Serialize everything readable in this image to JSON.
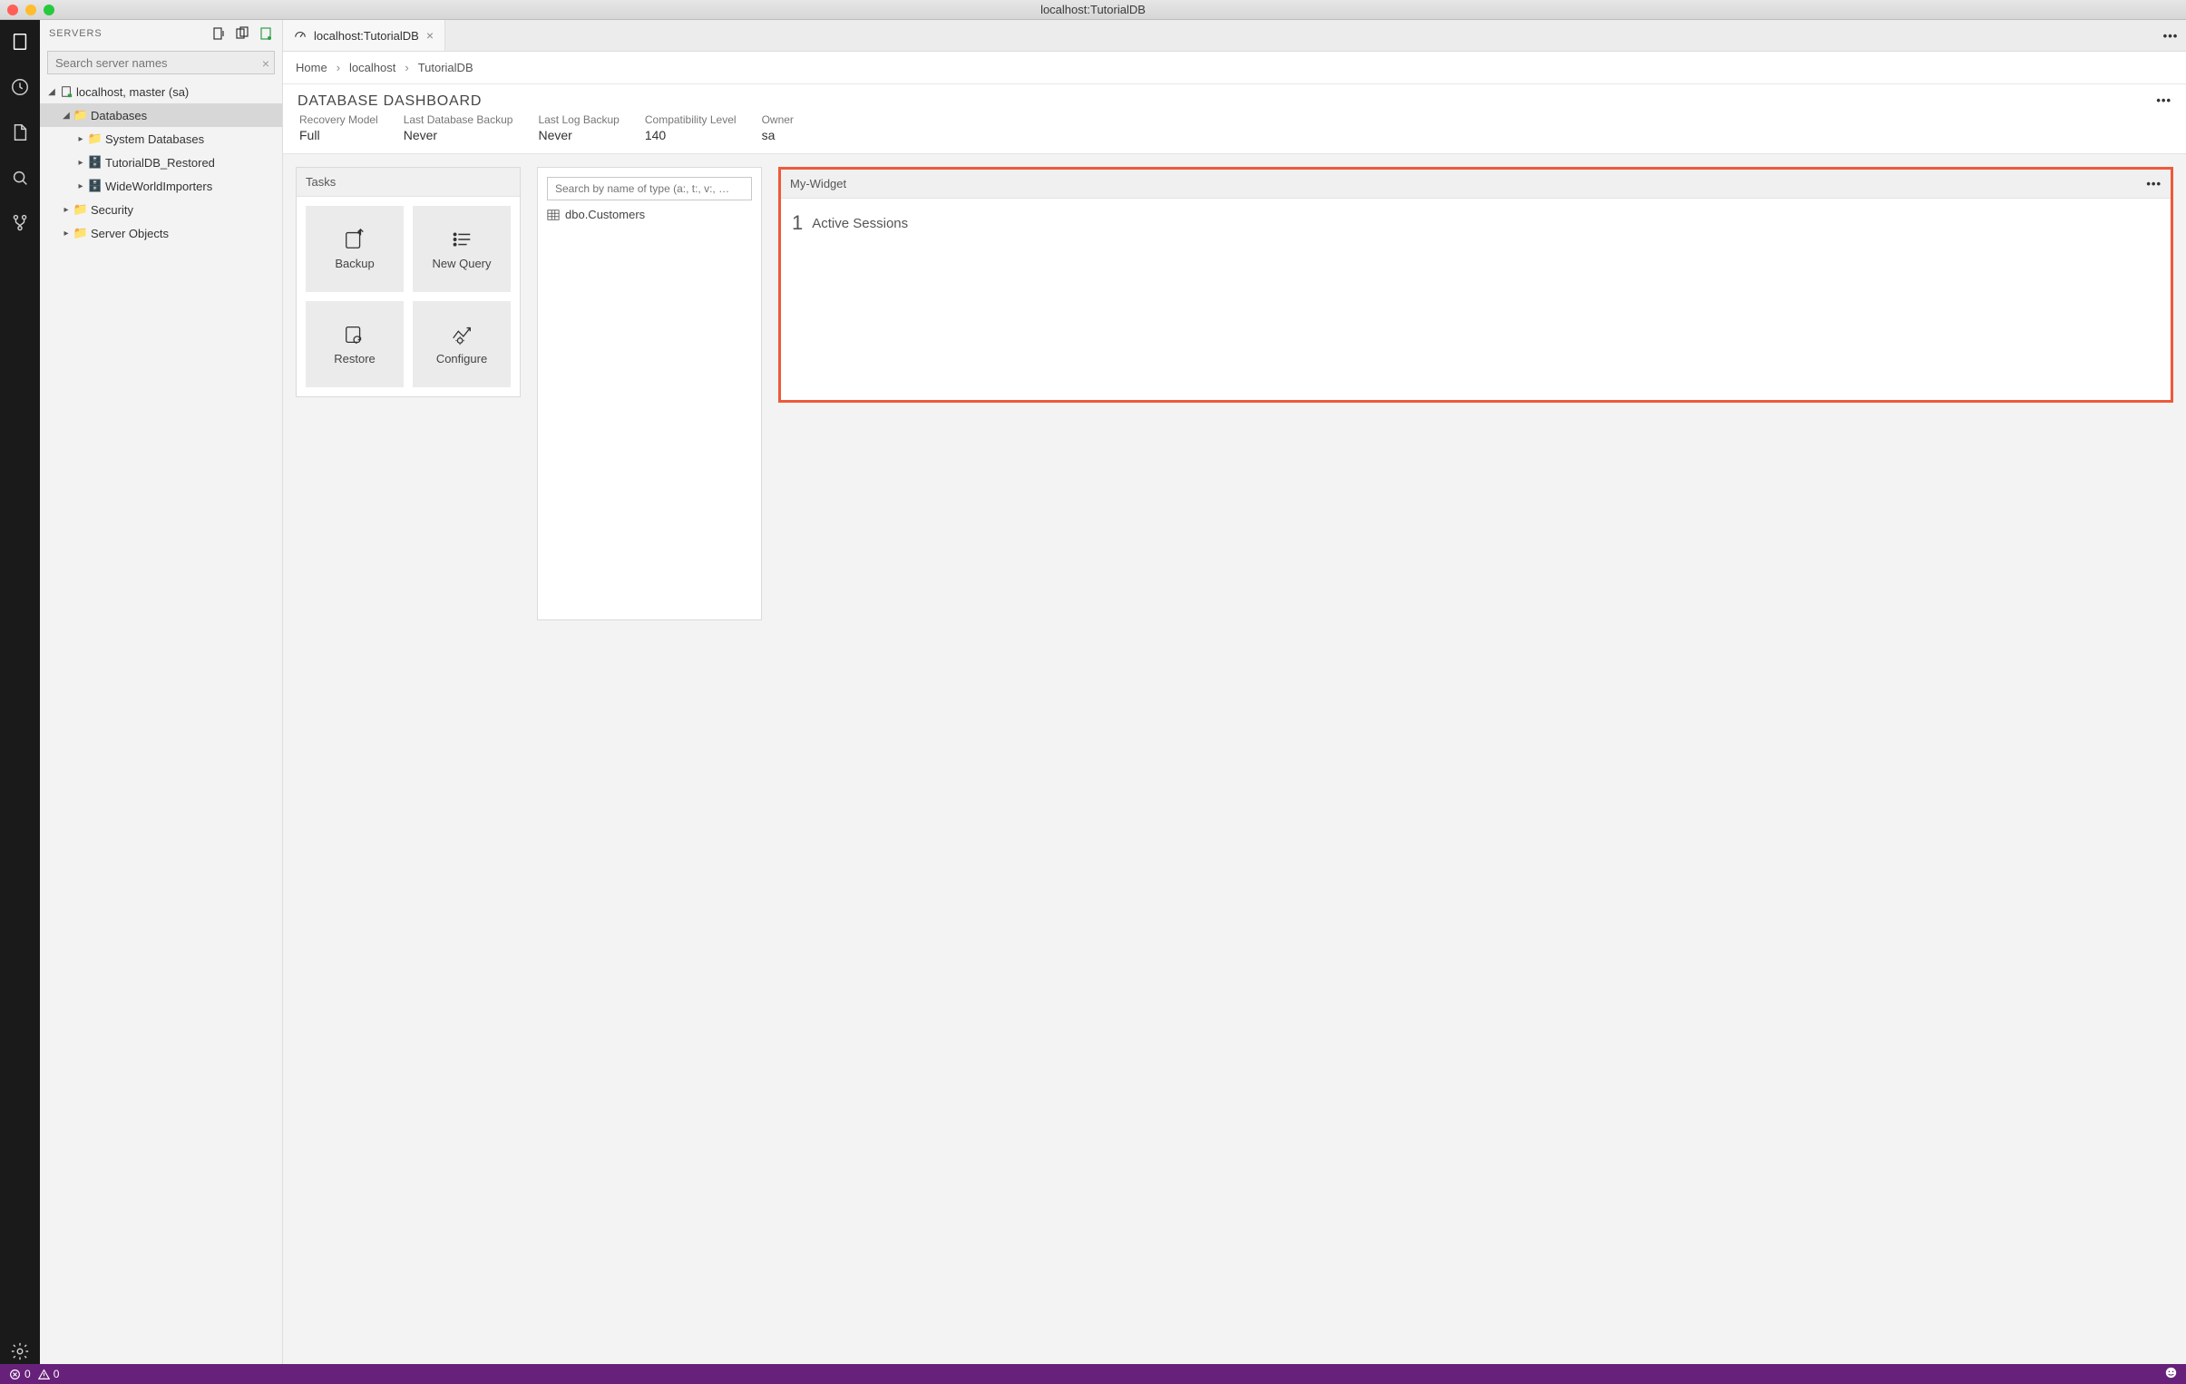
{
  "window": {
    "title": "localhost:TutorialDB"
  },
  "sidebar": {
    "title": "SERVERS",
    "search_placeholder": "Search server names",
    "tree": {
      "server": "localhost, master (sa)",
      "databases": "Databases",
      "system_dbs": "System Databases",
      "tutorial_restored": "TutorialDB_Restored",
      "wide_world": "WideWorldImporters",
      "security": "Security",
      "server_objects": "Server Objects"
    }
  },
  "tab": {
    "label": "localhost:TutorialDB"
  },
  "breadcrumbs": [
    "Home",
    "localhost",
    "TutorialDB"
  ],
  "dashboard": {
    "title": "DATABASE DASHBOARD",
    "props": [
      {
        "label": "Recovery Model",
        "value": "Full"
      },
      {
        "label": "Last Database Backup",
        "value": "Never"
      },
      {
        "label": "Last Log Backup",
        "value": "Never"
      },
      {
        "label": "Compatibility Level",
        "value": "140"
      },
      {
        "label": "Owner",
        "value": "sa"
      }
    ]
  },
  "tasks": {
    "title": "Tasks",
    "tiles": {
      "backup": "Backup",
      "newquery": "New Query",
      "restore": "Restore",
      "configure": "Configure"
    }
  },
  "typesearch": {
    "placeholder": "Search by name of type (a:, t:, v:, …",
    "result0": "dbo.Customers"
  },
  "mywidget": {
    "title": "My-Widget",
    "count": "1",
    "label": "Active Sessions"
  },
  "statusbar": {
    "errors": "0",
    "warnings": "0"
  }
}
